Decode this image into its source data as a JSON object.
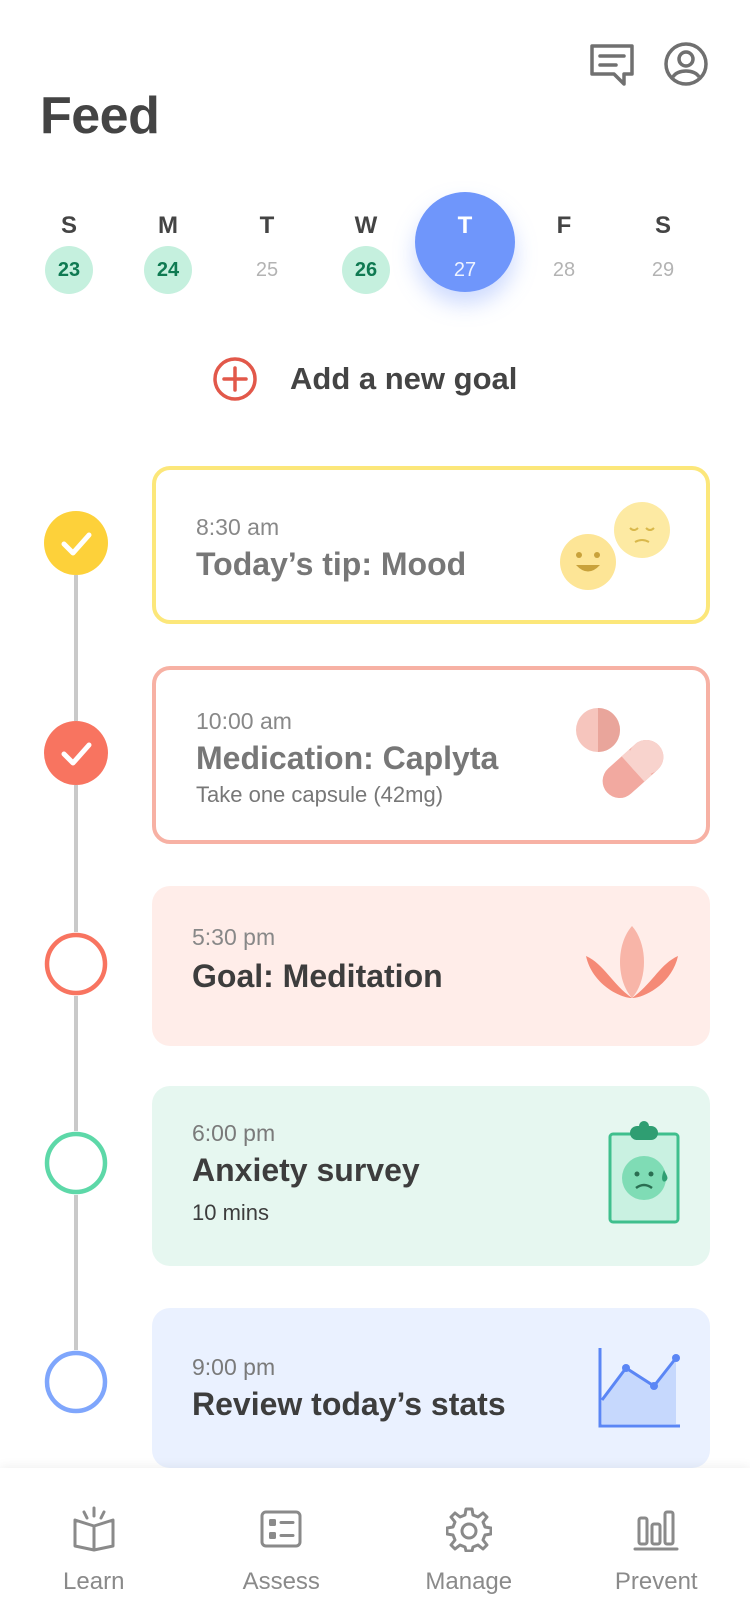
{
  "header": {
    "title": "Feed",
    "messages_icon": "messages-icon",
    "profile_icon": "profile-icon"
  },
  "week": [
    {
      "dow": "S",
      "date": "23",
      "status": "done"
    },
    {
      "dow": "M",
      "date": "24",
      "status": "done"
    },
    {
      "dow": "T",
      "date": "25",
      "status": "none"
    },
    {
      "dow": "W",
      "date": "26",
      "status": "done"
    },
    {
      "dow": "T",
      "date": "27",
      "status": "today"
    },
    {
      "dow": "F",
      "date": "28",
      "status": "none"
    },
    {
      "dow": "S",
      "date": "29",
      "status": "none"
    }
  ],
  "add_goal": {
    "label": "Add a new goal",
    "icon": "add-circle-icon"
  },
  "feed": {
    "items": [
      {
        "time": "8:30 am",
        "title": "Today’s tip: Mood",
        "subtitle": "",
        "completed": true,
        "accent": "#fdd13a",
        "icon": "mood-faces-icon"
      },
      {
        "time": "10:00 am",
        "title": "Medication: Caplyta",
        "subtitle": "Take one capsule (42mg)",
        "completed": true,
        "accent": "#f87460",
        "icon": "pills-icon"
      },
      {
        "time": "5:30 pm",
        "title": "Goal: Meditation",
        "subtitle": "",
        "completed": false,
        "accent": "#f87460",
        "icon": "lotus-icon"
      },
      {
        "time": "6:00 pm",
        "title": "Anxiety survey",
        "subtitle": "10 mins",
        "completed": false,
        "accent": "#5dd8a8",
        "icon": "clipboard-icon"
      },
      {
        "time": "9:00 pm",
        "title": "Review today’s stats",
        "subtitle": "",
        "completed": false,
        "accent": "#7fa6fc",
        "icon": "line-chart-icon"
      }
    ]
  },
  "tabbar": {
    "items": [
      {
        "label": "Learn",
        "icon": "book-icon"
      },
      {
        "label": "Assess",
        "icon": "checklist-icon"
      },
      {
        "label": "Manage",
        "icon": "gear-icon"
      },
      {
        "label": "Prevent",
        "icon": "bar-chart-icon"
      }
    ]
  },
  "colors": {
    "accent_blue": "#6f96fb",
    "done_green_bg": "#c5f0de",
    "done_green_text": "#0f7a52",
    "tip_border": "#fce77a",
    "med_border": "#f7b1a4",
    "meditation_bg": "#ffede9",
    "survey_bg": "#e6f7f0",
    "stats_bg": "#eaf1ff",
    "add_goal_red": "#e2584a"
  }
}
